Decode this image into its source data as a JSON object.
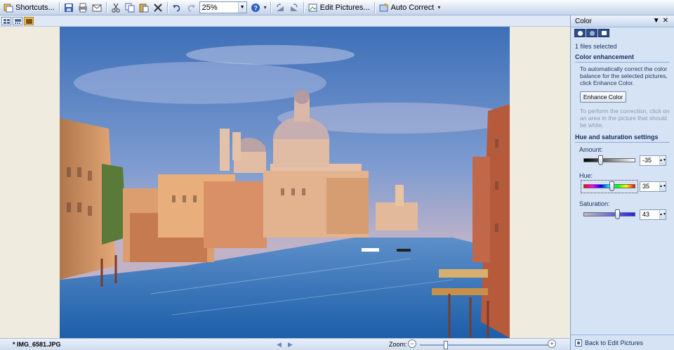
{
  "toolbar": {
    "shortcuts_label": "Shortcuts...",
    "zoom_value": "25%",
    "edit_pictures_label": "Edit Pictures...",
    "auto_correct_label": "Auto Correct"
  },
  "statusbar": {
    "file_name": "* IMG_6581.JPG",
    "zoom_label": "Zoom:",
    "zoom_level_fraction": 0.2
  },
  "pane": {
    "title": "Color",
    "files_selected": "1 files selected",
    "color_enhancement_title": "Color enhancement",
    "color_enhancement_desc": "To automatically correct the color balance for the selected pictures, click Enhance Color.",
    "enhance_button": "Enhance Color",
    "enhance_hint": "To perform the correction, click on an area in the picture that should be white.",
    "hue_sat_title": "Hue and saturation settings",
    "amount_label": "Amount:",
    "amount_value": "-35",
    "amount_fraction": 0.33,
    "hue_label": "Hue:",
    "hue_value": "35",
    "hue_fraction": 0.55,
    "saturation_label": "Saturation:",
    "saturation_value": "43",
    "saturation_fraction": 0.67,
    "back_link": "Back to Edit Pictures"
  },
  "colors": {
    "pane_background": "#d6e3f5",
    "section_title": "#15305f",
    "nav_button": "#2e4f8f"
  }
}
